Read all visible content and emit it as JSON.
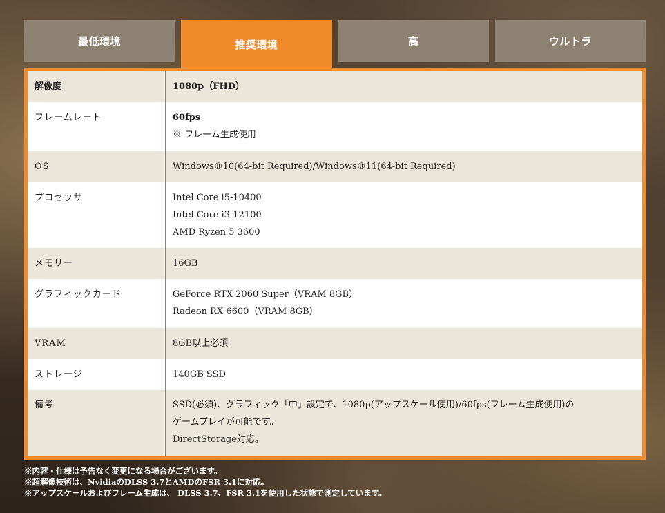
{
  "tabs": [
    {
      "label": "最低環境",
      "active": false
    },
    {
      "label": "推奨環境",
      "active": true
    },
    {
      "label": "高",
      "active": false
    },
    {
      "label": "ウルトラ",
      "active": false
    }
  ],
  "specs": [
    {
      "label": "解像度",
      "lines": [
        "1080p（FHD）"
      ]
    },
    {
      "label": "フレームレート",
      "lines": [
        "60fps",
        "※ フレーム生成使用"
      ]
    },
    {
      "label": "OS",
      "lines": [
        "Windows®10(64-bit Required)/Windows®11(64-bit Required)"
      ]
    },
    {
      "label": "プロセッサ",
      "lines": [
        "Intel Core i5-10400",
        "Intel Core i3-12100",
        "AMD Ryzen 5 3600"
      ]
    },
    {
      "label": "メモリー",
      "lines": [
        "16GB"
      ]
    },
    {
      "label": "グラフィックカード",
      "lines": [
        "GeForce RTX 2060 Super（VRAM 8GB）",
        "Radeon RX 6600（VRAM 8GB）"
      ]
    },
    {
      "label": "VRAM",
      "lines": [
        "8GB以上必須"
      ]
    },
    {
      "label": "ストレージ",
      "lines": [
        "140GB SSD"
      ]
    },
    {
      "label": "備考",
      "lines": [
        "SSD(必須)、グラフィック「中」設定で、1080p(アップスケール使用)/60fps(フレーム生成使用)の",
        "ゲームプレイが可能です。",
        "DirectStorage対応。"
      ]
    }
  ],
  "notes": [
    "※内容・仕様は予告なく変更になる場合がございます。",
    "※超解像技術は、NvidiaのDLSS 3.7とAMDのFSR 3.1に対応。",
    "※アップスケールおよびフレーム生成は、 DLSS 3.7、FSR 3.1を使用した状態で測定しています。"
  ],
  "colors": {
    "accent": "#f08a2b",
    "tab_inactive": "#8d8271",
    "row_shade": "#ebe6da"
  }
}
